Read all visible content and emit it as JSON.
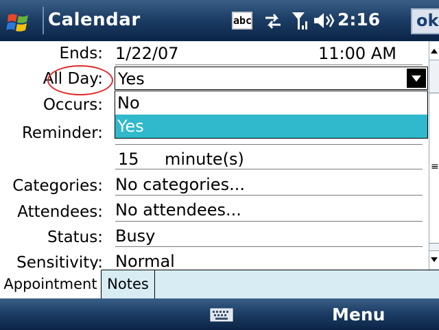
{
  "titlebar": {
    "app_title": "Calendar",
    "input_mode": "abc",
    "time": "2:16",
    "ok_label": "ok",
    "icons": [
      "windows-start-icon",
      "sync-icon",
      "signal-icon",
      "volume-icon"
    ]
  },
  "form": {
    "ends": {
      "label": "Ends:",
      "date": "1/22/07",
      "time": "11:00 AM"
    },
    "all_day": {
      "label": "All Day:",
      "value": "Yes",
      "options": [
        "No",
        "Yes"
      ],
      "highlighted": "Yes"
    },
    "occurs": {
      "label": "Occurs:"
    },
    "reminder": {
      "label": "Reminder:",
      "amount": "15",
      "unit": "minute(s)"
    },
    "categories": {
      "label": "Categories:",
      "value": "No categories..."
    },
    "attendees": {
      "label": "Attendees:",
      "value": "No attendees..."
    },
    "status": {
      "label": "Status:",
      "value": "Busy"
    },
    "sensitivity": {
      "label": "Sensitivity:",
      "value": "Normal"
    }
  },
  "tabs": [
    {
      "label": "Appointment",
      "active": true
    },
    {
      "label": "Notes",
      "active": false
    }
  ],
  "softkeys": {
    "menu_label": "Menu"
  },
  "colors": {
    "titlebar": "#1d3e66",
    "highlight": "#30b9cc",
    "annotation_circle": "#e0282a",
    "tab_strip": "#d8ecf4"
  }
}
